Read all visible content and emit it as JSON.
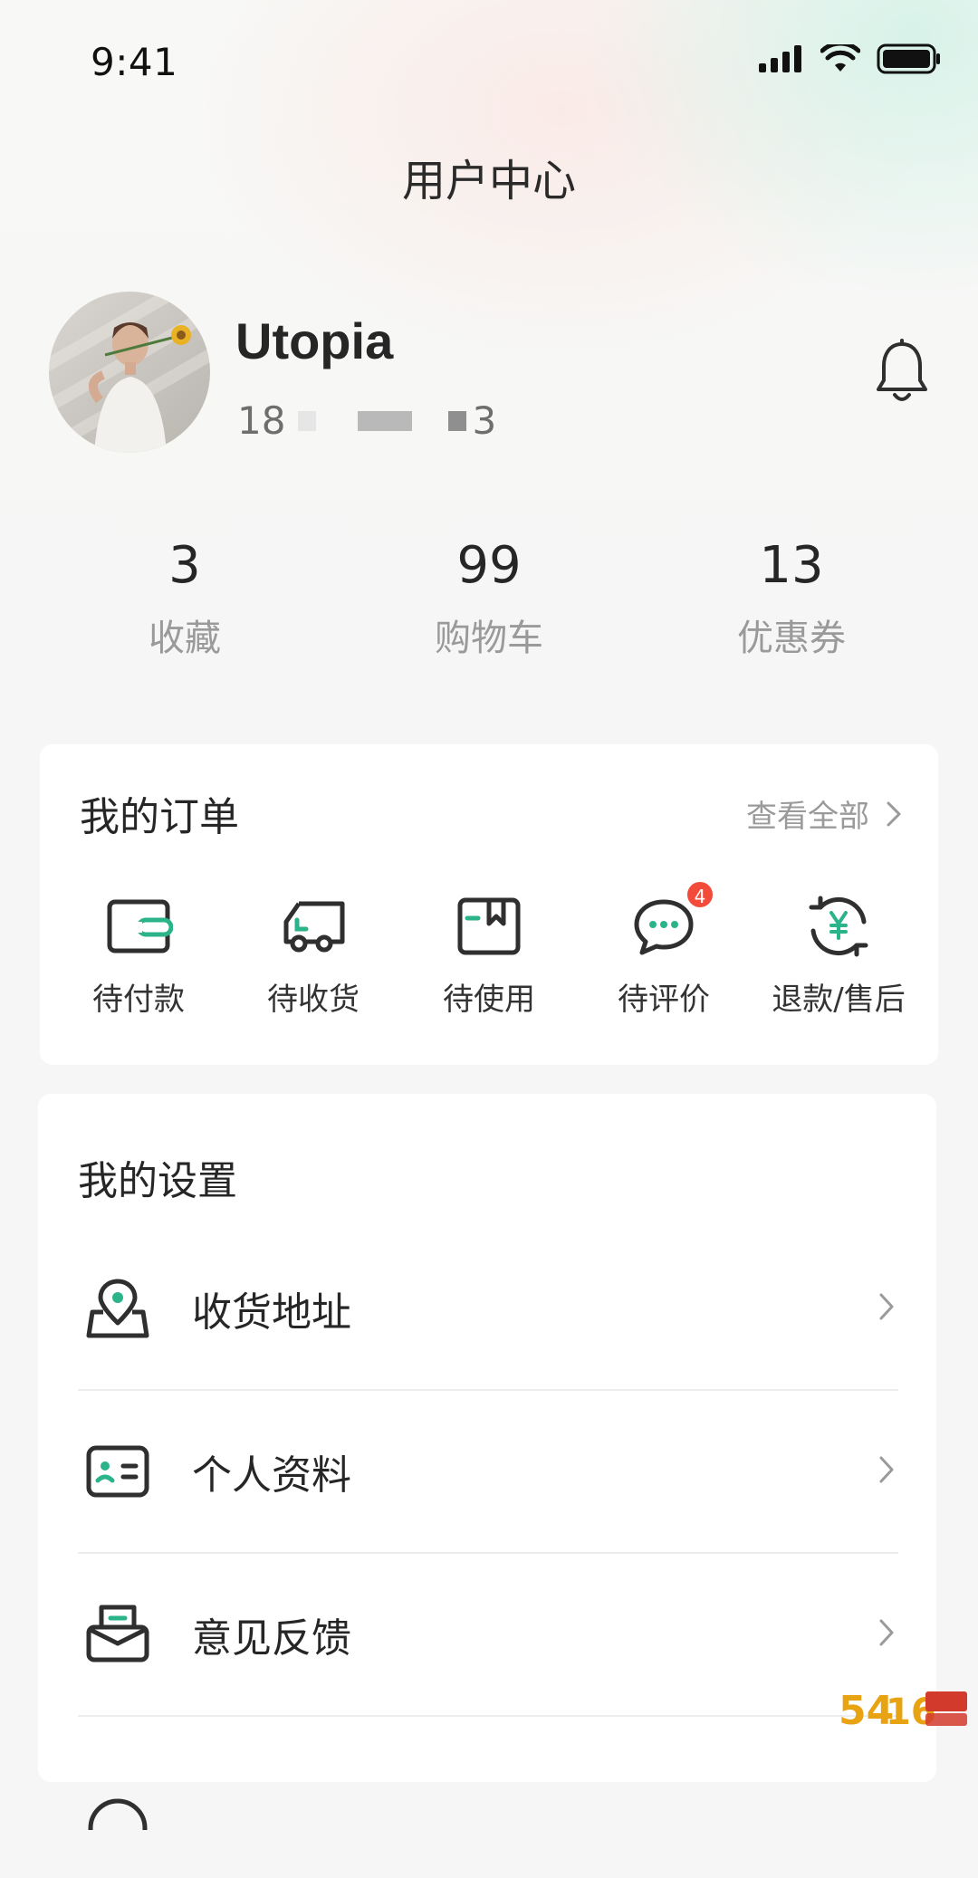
{
  "status_bar": {
    "time": "9:41",
    "icons": [
      "signal-icon",
      "wifi-icon",
      "battery-icon"
    ]
  },
  "header": {
    "title": "用户中心"
  },
  "profile": {
    "name": "Utopia",
    "phone_prefix": "18",
    "phone_suffix": "3",
    "phone_masked": true,
    "bell_icon": "bell-icon"
  },
  "stats": [
    {
      "value": "3",
      "label": "收藏"
    },
    {
      "value": "99",
      "label": "购物车"
    },
    {
      "value": "13",
      "label": "优惠券"
    }
  ],
  "orders": {
    "title": "我的订单",
    "view_all": "查看全部",
    "items": [
      {
        "label": "待付款",
        "icon": "wallet-icon"
      },
      {
        "label": "待收货",
        "icon": "truck-icon"
      },
      {
        "label": "待使用",
        "icon": "box-icon"
      },
      {
        "label": "待评价",
        "icon": "comment-icon",
        "badge": "4"
      },
      {
        "label": "退款/售后",
        "icon": "refund-icon"
      }
    ]
  },
  "settings": {
    "title": "我的设置",
    "items": [
      {
        "label": "收货地址",
        "icon": "location-icon"
      },
      {
        "label": "个人资料",
        "icon": "id-card-icon"
      },
      {
        "label": "意见反馈",
        "icon": "feedback-icon"
      }
    ]
  },
  "colors": {
    "accent": "#2bb38a",
    "badge": "#f24b3a",
    "text_primary": "#262626",
    "text_secondary": "#9a9a9a",
    "icon_stroke": "#2f2f2f"
  }
}
